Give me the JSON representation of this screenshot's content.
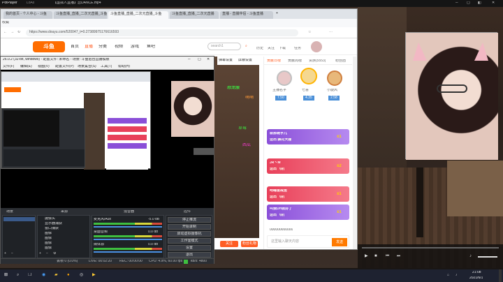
{
  "potplayer": {
    "app_name": "PotPlayer",
    "menu": "LoAs",
    "title": "【虚拟人直播】恋DANCE.mp4"
  },
  "browser": {
    "tabs": [
      {
        "label": "我的首页 - 个人中心 - 斗鱼"
      },
      {
        "label": "斗鱼直播_直播_二次元直播_斗鱼"
      },
      {
        "label": "斗鱼直播_直播_二次元直播_斗鱼"
      },
      {
        "label": "斗鱼直播_直播_二次元直播"
      },
      {
        "label": "直播 - 直播伴侣 - 斗鱼直播"
      }
    ],
    "bookmark": "收藏",
    "address": "https://www.douyu.com/520047_t=0.27389975176616593",
    "nav": [
      "首页",
      "直播",
      "分类",
      "视频",
      "游戏",
      "鱼吧"
    ],
    "search_placeholder": "search1",
    "top_icons": [
      "历史",
      "关注",
      "下载",
      "任务",
      "消息"
    ],
    "sub_toolbar": [
      "弹幕设置",
      "屏蔽设置"
    ]
  },
  "obs": {
    "title": "26.0.2 (32-bit, windows) - 配置文件: 未命名 - 场景: 斗鱼后台直播模板",
    "menu": [
      "文件(F)",
      "编辑(E)",
      "视图(V)",
      "配置文件(P)",
      "场景集合(S)",
      "工具(T)",
      "帮助(H)"
    ],
    "panel_headers": {
      "scenes": "场景",
      "sources": "来源",
      "mixer": "混音器",
      "transitions": "转场",
      "controls": "控件"
    },
    "sources": [
      "摄像头",
      "显示器捕获",
      "窗口捕获",
      "图像",
      "图像",
      "图像",
      "图像"
    ],
    "mixer_tracks": [
      {
        "name": "麦克风/Aux",
        "db": "-5.0 dB"
      },
      {
        "name": "桌面音频",
        "db": "0.0 dB"
      },
      {
        "name": "媒体源",
        "db": "0.0 dB"
      }
    ],
    "controls": [
      "停止推流",
      "开始录制",
      "启动虚拟摄像机",
      "工作室模式",
      "设置",
      "退出"
    ],
    "status": {
      "dropped": "丢帧 0 (0.0%)",
      "live": "LIVE: 00:02:20",
      "rec": "REC: 00:00:00",
      "cpu": "CPU: 4.9%, 60.00 fps",
      "bitrate": "kb/s: 4800"
    }
  },
  "stream": {
    "chat_tabs": [
      "贡献日榜",
      "贡献周榜",
      "贵族(5553)",
      "粉丝团"
    ],
    "rank_names": [
      "主播名字",
      "七喜",
      "小旋风"
    ],
    "rank_scores": [
      "7.50",
      "4.35",
      "2.58"
    ],
    "overlay_texts": [
      "恐龙服",
      "萌萌",
      "草莓",
      "西瓜"
    ],
    "gifts": [
      {
        "user": "就那碗字儿",
        "gift": "送出 飘花大棚",
        "count": "x1",
        "color": "#8a4fd8"
      },
      {
        "user": "JR丶M",
        "gift": "送出 飞机",
        "count": "x2",
        "color": "#e8405a"
      },
      {
        "user": "吻睡鉴戒鱼",
        "gift": "送出 飞机",
        "count": "x1",
        "color": "#e8405a"
      },
      {
        "user": "叫我DH就好了",
        "gift": "送出 飞机",
        "count": "x1",
        "color": "#8a4fd8"
      }
    ],
    "chat_input_placeholder": "这里输入聊天内容",
    "send": "发送",
    "chat_line": "000000000000",
    "fan_button": "粉丝礼物",
    "follow_button": "关注"
  },
  "taskbar": {
    "time": "21:08",
    "date": "2021/6/1"
  }
}
